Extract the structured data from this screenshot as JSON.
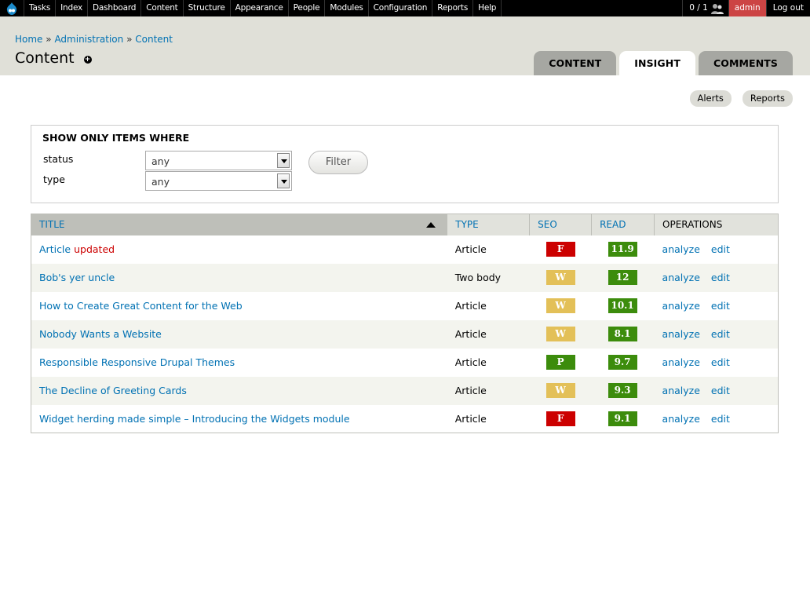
{
  "toolbar": {
    "menu": [
      "Tasks",
      "Index",
      "Dashboard",
      "Content",
      "Structure",
      "Appearance",
      "People",
      "Modules",
      "Configuration",
      "Reports",
      "Help"
    ],
    "users_count": "0 / 1",
    "user": "admin",
    "logout": "Log out"
  },
  "breadcrumb": {
    "items": [
      "Home",
      "Administration",
      "Content"
    ],
    "separator": "»"
  },
  "page": {
    "title": "Content",
    "add_shortcut": "+"
  },
  "tabs": [
    {
      "label": "CONTENT",
      "active": false
    },
    {
      "label": "INSIGHT",
      "active": true
    },
    {
      "label": "COMMENTS",
      "active": false
    }
  ],
  "actions": {
    "alerts": "Alerts",
    "reports": "Reports"
  },
  "filter": {
    "title": "SHOW ONLY ITEMS WHERE",
    "status_label": "status",
    "status_value": "any",
    "type_label": "type",
    "type_value": "any",
    "button": "Filter"
  },
  "table": {
    "headers": {
      "title": "TITLE",
      "type": "TYPE",
      "seo": "SEO",
      "read": "READ",
      "operations": "OPERATIONS"
    },
    "analyze_label": "analyze",
    "edit_label": "edit",
    "rows": [
      {
        "title": "Article",
        "flag": "updated",
        "type": "Article",
        "seo": "F",
        "read": "11.9"
      },
      {
        "title": "Bob's yer uncle",
        "flag": "",
        "type": "Two body",
        "seo": "W",
        "read": "12"
      },
      {
        "title": "How to Create Great Content for the Web",
        "flag": "",
        "type": "Article",
        "seo": "W",
        "read": "10.1"
      },
      {
        "title": "Nobody Wants a Website",
        "flag": "",
        "type": "Article",
        "seo": "W",
        "read": "8.1"
      },
      {
        "title": "Responsible Responsive Drupal Themes",
        "flag": "",
        "type": "Article",
        "seo": "P",
        "read": "9.7"
      },
      {
        "title": "The Decline of Greeting Cards",
        "flag": "",
        "type": "Article",
        "seo": "W",
        "read": "9.3"
      },
      {
        "title": "Widget herding made simple – Introducing the Widgets module",
        "flag": "",
        "type": "Article",
        "seo": "F",
        "read": "9.1"
      }
    ]
  },
  "colors": {
    "seo_fail": "#cc0000",
    "seo_warn": "#e3c058",
    "seo_pass": "#3c8c0c",
    "read": "#3c8c0c",
    "link": "#0071b3",
    "admin_bg": "#cc4444"
  }
}
